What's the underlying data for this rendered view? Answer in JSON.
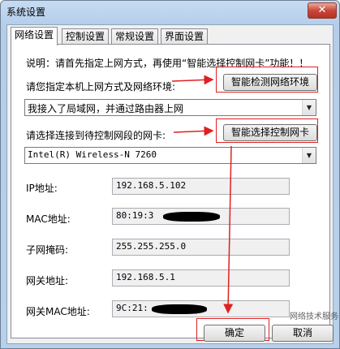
{
  "window": {
    "title": "系统设置",
    "close_label": "✕"
  },
  "tabs": [
    {
      "label": "网络设置"
    },
    {
      "label": "控制设置"
    },
    {
      "label": "常规设置"
    },
    {
      "label": "界面设置"
    }
  ],
  "network": {
    "note": "说明：请首先指定上网方式，再使用“智能选择控制网卡”功能！！",
    "mode_label": "请您指定本机上网方式及网络环境:",
    "detect_button": "智能检测网络环境",
    "mode_value": "我接入了局域网，并通过路由器上网",
    "nic_label": "请选择连接到待控制网段的网卡:",
    "select_nic_button": "智能选择控制网卡",
    "nic_value": "Intel(R) Wireless-N 7260",
    "ip_label": "IP地址:",
    "ip_value": "192.168.5.102",
    "mac_label": "MAC地址:",
    "mac_value": "80:19:3",
    "mask_label": "子网掩码:",
    "mask_value": "255.255.255.0",
    "gateway_label": "网关地址:",
    "gateway_value": "192.168.5.1",
    "gateway_mac_label": "网关MAC地址:",
    "gateway_mac_value": "9C:21:"
  },
  "footer": {
    "ok_label": "确定",
    "cancel_label": "取消",
    "watermark": "网络技术服务谷"
  },
  "colors": {
    "annotation": "#e02020"
  }
}
